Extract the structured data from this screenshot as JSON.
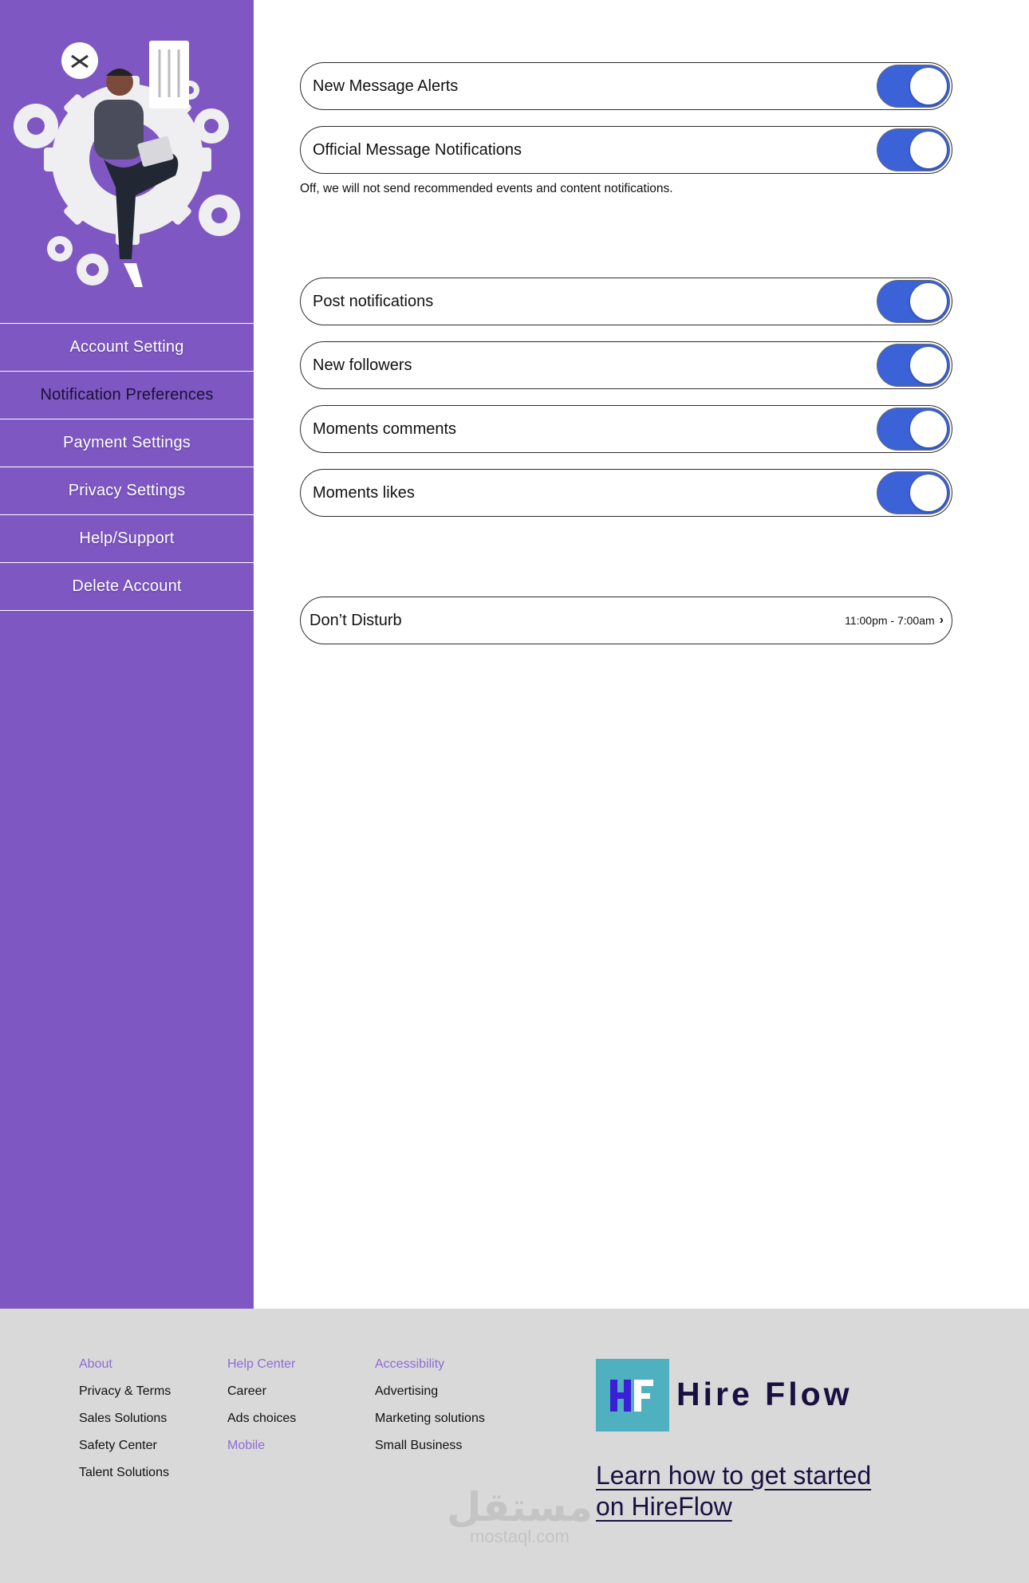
{
  "sidebar": {
    "nav": [
      {
        "label": "Account Setting",
        "active": false
      },
      {
        "label": "Notification Preferences",
        "active": true
      },
      {
        "label": "Payment Settings",
        "active": false
      },
      {
        "label": "Privacy Settings",
        "active": false
      },
      {
        "label": "Help/Support",
        "active": false
      },
      {
        "label": "Delete Account",
        "active": false
      }
    ],
    "illustration": "person-with-laptop-and-gears",
    "background": "#7e57c2"
  },
  "settings": {
    "group1": [
      {
        "label": "New Message Alerts",
        "on": true
      },
      {
        "label": "Official Message Notifications",
        "on": true
      }
    ],
    "hint": "Off, we will not send recommended events and content notifications.",
    "group2": [
      {
        "label": "Post notifications",
        "on": true
      },
      {
        "label": "New followers",
        "on": true
      },
      {
        "label": "Moments comments",
        "on": true
      },
      {
        "label": "Moments likes",
        "on": true
      }
    ],
    "dont_disturb": {
      "label": "Don’t Disturb",
      "time": "11:00pm - 7:00am"
    },
    "toggle_color": "#3c62d8"
  },
  "footer": {
    "col1": [
      "About",
      "Privacy & Terms",
      "Sales Solutions",
      "Safety Center",
      "Talent Solutions"
    ],
    "col2": [
      "Help Center",
      "Career",
      "Ads choices",
      "Mobile"
    ],
    "col3": [
      "Accessibility",
      "Advertising",
      "Marketing solutions",
      "Small Business"
    ],
    "brand": {
      "initials": "HF",
      "name": "Hire Flow",
      "box_color": "#4fb0bf"
    },
    "learn_line1": "Learn how to get started",
    "learn_line2": "on HireFlow",
    "watermark": {
      "arabic": "مستقل",
      "latin": "mostaql.com"
    },
    "accent": "#8c6cd6"
  }
}
